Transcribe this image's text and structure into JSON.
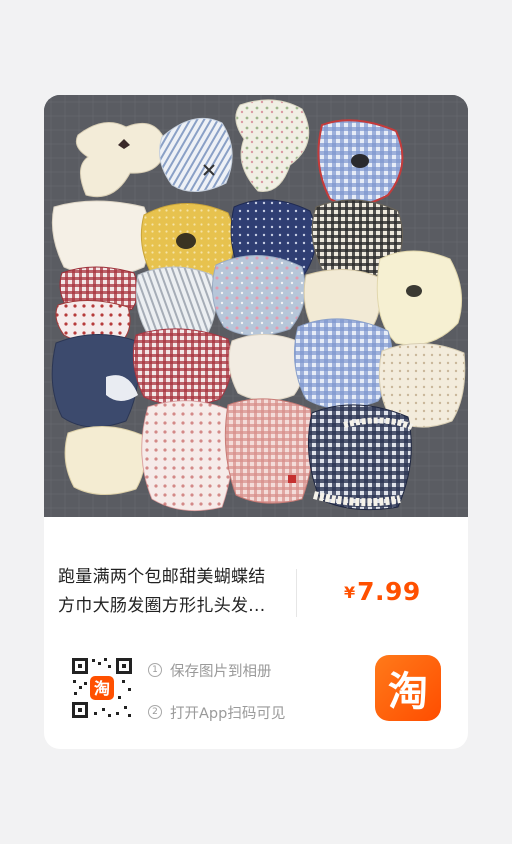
{
  "product": {
    "title_line1": "跑量满两个包邮甜美蝴蝶结",
    "title_line2": "方巾大肠发圈方形扎头发...",
    "price_symbol": "¥",
    "price_value": "7.99"
  },
  "share": {
    "step1_num": "1",
    "step1_text": "保存图片到相册",
    "step2_num": "2",
    "step2_text": "打开App扫码可见",
    "qr_center_glyph": "淘",
    "logo_glyph": "淘"
  },
  "colors": {
    "price": "#ff5000",
    "brand": "#ff5000",
    "background": "#f2f2f3"
  }
}
